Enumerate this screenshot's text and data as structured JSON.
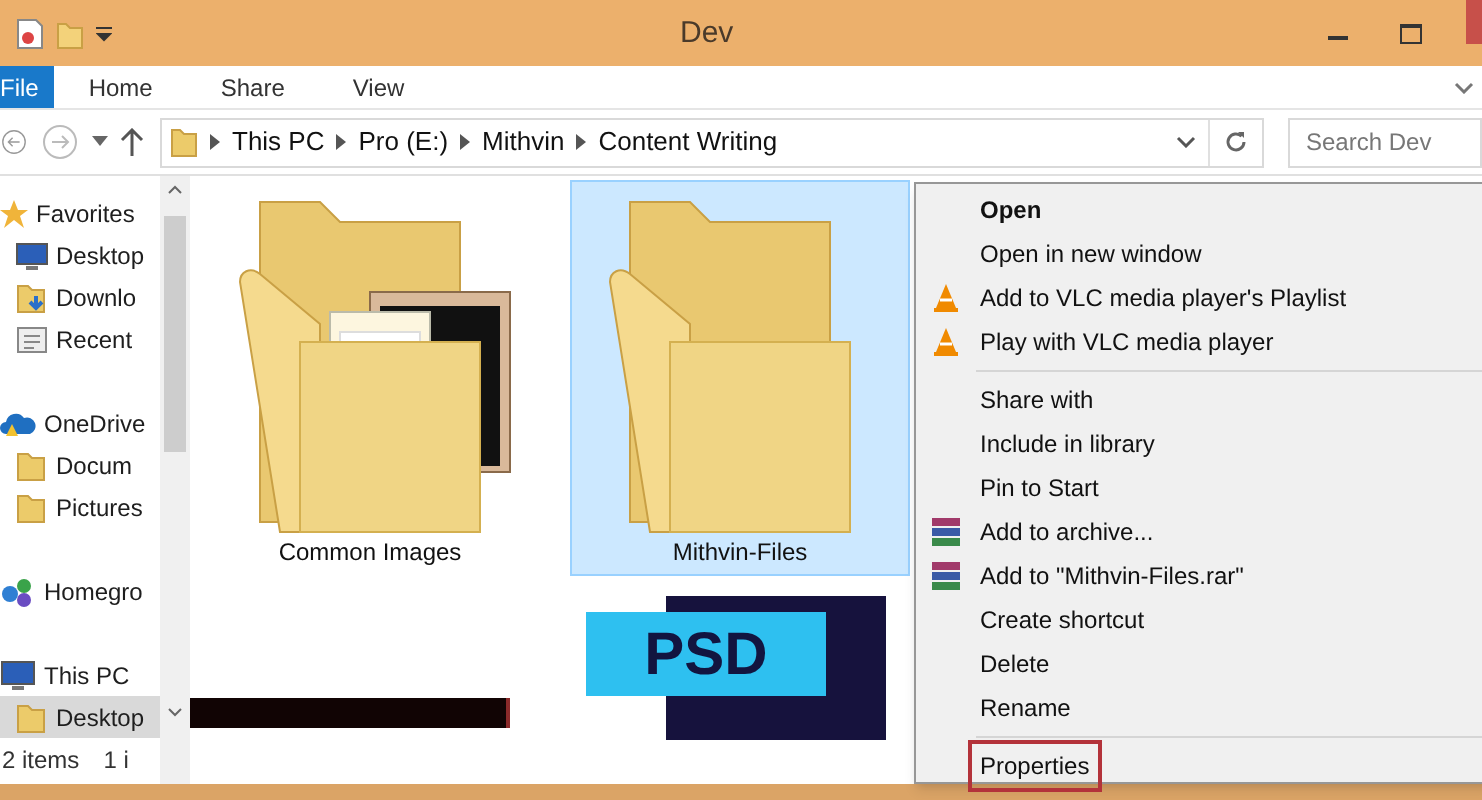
{
  "window": {
    "title": "Dev"
  },
  "ribbon_tabs": [
    {
      "label": "File",
      "selected": true
    },
    {
      "label": "Home",
      "selected": false
    },
    {
      "label": "Share",
      "selected": false
    },
    {
      "label": "View",
      "selected": false
    }
  ],
  "address_bar": {
    "path": [
      "This PC",
      "Pro (E:)",
      "Mithvin",
      "Content Writing"
    ]
  },
  "search": {
    "placeholder": "Search Dev"
  },
  "navigation_pane": [
    {
      "label": "Favorites",
      "kind": "star",
      "group": true,
      "selected": false
    },
    {
      "label": "Desktop",
      "kind": "monitor",
      "group": false,
      "selected": false
    },
    {
      "label": "Downlo",
      "kind": "download",
      "group": false,
      "selected": false
    },
    {
      "label": "Recent",
      "kind": "recent",
      "group": false,
      "selected": false
    },
    {
      "label": "OneDrive",
      "kind": "cloud",
      "group": true,
      "selected": false
    },
    {
      "label": "Docum",
      "kind": "folder",
      "group": false,
      "selected": false
    },
    {
      "label": "Pictures",
      "kind": "folder",
      "group": false,
      "selected": false
    },
    {
      "label": "Homegro",
      "kind": "homegroup",
      "group": true,
      "selected": false
    },
    {
      "label": "This PC",
      "kind": "pc",
      "group": true,
      "selected": false
    },
    {
      "label": "Desktop",
      "kind": "folder",
      "group": false,
      "selected": true
    }
  ],
  "files": [
    {
      "name": "Common Images",
      "kind": "folder-images",
      "selected": false
    },
    {
      "name": "Mithvin-Files",
      "kind": "folder",
      "selected": true
    },
    {
      "kind": "dark-thumb"
    },
    {
      "kind": "psd",
      "badge": "PSD"
    }
  ],
  "status_bar": [
    "2 items",
    "1 i"
  ],
  "context_menu": [
    {
      "label": "Open",
      "kind": "plain",
      "bold": true,
      "highlighted": false
    },
    {
      "label": "Open in new window",
      "kind": "plain",
      "bold": false,
      "highlighted": false
    },
    {
      "label": "Add to VLC media player's Playlist",
      "kind": "vlc",
      "bold": false,
      "highlighted": false
    },
    {
      "label": "Play with VLC media player",
      "kind": "vlc",
      "bold": false,
      "highlighted": false
    },
    {
      "kind": "separator"
    },
    {
      "label": "Share with",
      "kind": "plain",
      "bold": false,
      "highlighted": false
    },
    {
      "label": "Include in library",
      "kind": "plain",
      "bold": false,
      "highlighted": false
    },
    {
      "label": "Pin to Start",
      "kind": "plain",
      "bold": false,
      "highlighted": false
    },
    {
      "label": "Add to archive...",
      "kind": "rar",
      "bold": false,
      "highlighted": false
    },
    {
      "label": "Add to \"Mithvin-Files.rar\"",
      "kind": "rar",
      "bold": false,
      "highlighted": false
    },
    {
      "label": "Create shortcut",
      "kind": "plain",
      "bold": false,
      "highlighted": false
    },
    {
      "label": "Delete",
      "kind": "plain",
      "bold": false,
      "highlighted": false
    },
    {
      "label": "Rename",
      "kind": "plain",
      "bold": false,
      "highlighted": false
    },
    {
      "kind": "separator"
    },
    {
      "label": "Properties",
      "kind": "plain",
      "bold": false,
      "highlighted": true
    }
  ]
}
